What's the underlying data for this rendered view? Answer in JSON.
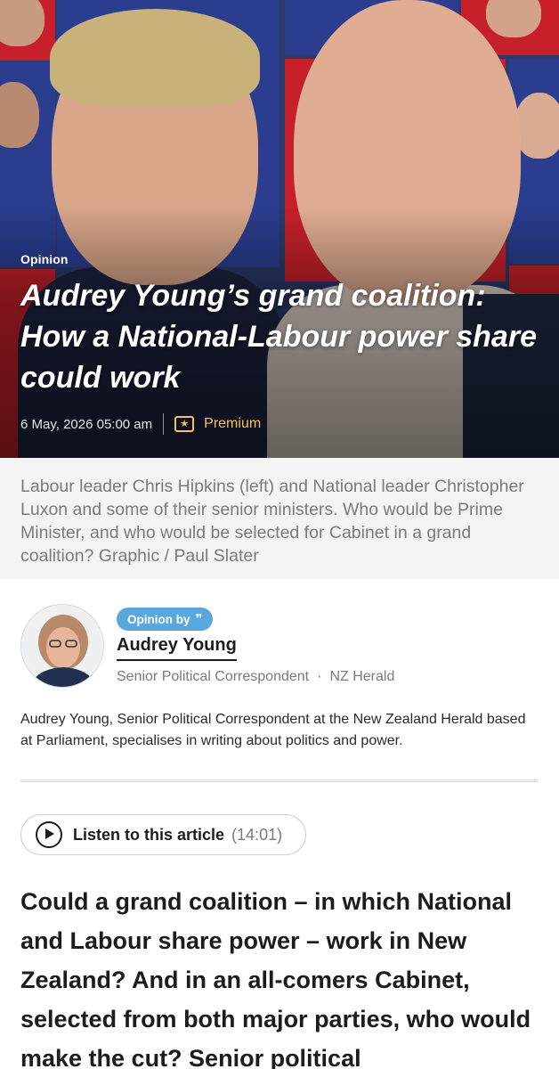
{
  "hero": {
    "label": "Opinion",
    "headline": "Audrey Young’s grand coalition: How a National-Labour power share could work",
    "date": "6 May, 2026 05:00 am",
    "premium_icon": "star-icon",
    "premium_label": "Premium",
    "accent_red": "#c8202a",
    "accent_blue": "#2a3d8f",
    "premium_color": "#f0c45a"
  },
  "caption": "Labour leader Chris Hipkins (left) and National leader Christopher Luxon and some of their senior ministers. Who would be Prime Minister, and who would be selected for Cabinet in a grand coalition? Graphic /  Paul Slater",
  "author": {
    "badge_label": "Opinion by",
    "badge_icon": "quote-icon",
    "name": "Audrey Young",
    "role": "Senior Political Correspondent",
    "separator": "·",
    "outlet": "NZ Herald",
    "badge_color": "#5aa7de"
  },
  "bio": "Audrey Young, Senior Political Correspondent at the New Zealand Herald based at Parliament, specialises in writing about politics and power.",
  "listen": {
    "icon": "play-icon",
    "label": "Listen to this article",
    "duration": "(14:01)"
  },
  "lead": "Could a grand coalition – in which National and Labour share power – work in New Zealand? And in an all-comers Cabinet, selected from both major parties, who would make the cut? Senior political"
}
